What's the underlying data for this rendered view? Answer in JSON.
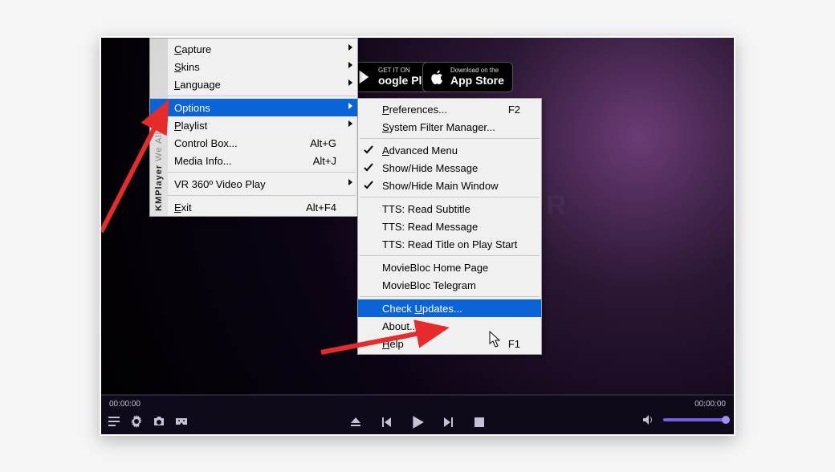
{
  "app_sidebar": {
    "brand": "KMPlayer",
    "tagline": " We All Enjoy!"
  },
  "badges": {
    "gplay": {
      "line1": "GET IT ON",
      "line2": "oogle Play"
    },
    "astore": {
      "line1": "Download on the",
      "line2": "App Store"
    }
  },
  "menu1": [
    {
      "label": "Capture",
      "submenu": true,
      "ul": 0
    },
    {
      "label": "Skins",
      "submenu": true,
      "ul": 0
    },
    {
      "label": "Language",
      "submenu": true,
      "ul": 0
    },
    {
      "sep": true
    },
    {
      "label": "Options",
      "submenu": true,
      "selected": true
    },
    {
      "label": "Playlist",
      "submenu": true,
      "ul": 0
    },
    {
      "label": "Control Box...",
      "shortcut": "Alt+G"
    },
    {
      "label": "Media Info...",
      "shortcut": "Alt+J"
    },
    {
      "sep": true
    },
    {
      "label": "VR 360º Video Play",
      "submenu": true
    },
    {
      "sep": true
    },
    {
      "label": "Exit",
      "shortcut": "Alt+F4",
      "ul": 0
    }
  ],
  "menu2": [
    {
      "label": "Preferences...",
      "shortcut": "F2",
      "ul": 0
    },
    {
      "label": "System Filter Manager...",
      "ul": 0
    },
    {
      "sep": true
    },
    {
      "label": "Advanced Menu",
      "checked": true,
      "ul": 0
    },
    {
      "label": "Show/Hide Message",
      "checked": true
    },
    {
      "label": "Show/Hide Main Window",
      "checked": true
    },
    {
      "sep": true
    },
    {
      "label": "TTS: Read Subtitle"
    },
    {
      "label": "TTS: Read Message"
    },
    {
      "label": "TTS: Read Title on Play Start"
    },
    {
      "sep": true
    },
    {
      "label": "MovieBloc Home Page"
    },
    {
      "label": "MovieBloc Telegram"
    },
    {
      "sep": true
    },
    {
      "label": "Check Updates...",
      "selected": true,
      "ul": 6
    },
    {
      "label": "About..."
    },
    {
      "label": "Help",
      "shortcut": "F1",
      "ul": 0
    }
  ],
  "player": {
    "time_current": "00:00:00",
    "time_total": "00:00:00"
  },
  "watermark": "QUICKFEVER"
}
